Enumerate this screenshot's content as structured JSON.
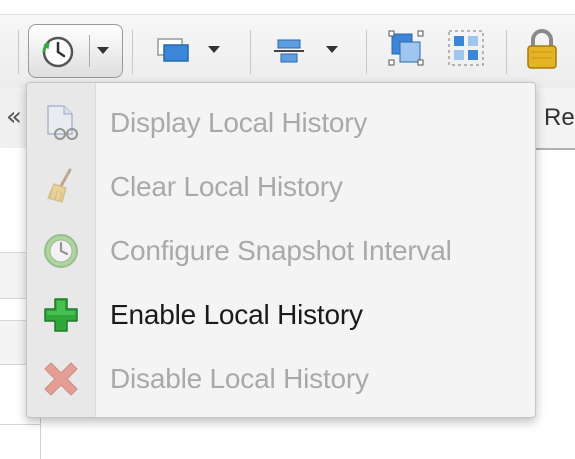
{
  "toolbar": {
    "buttons": [
      {
        "icon": "history-clock-icon",
        "has_dropdown": true,
        "state": "pressed"
      },
      {
        "icon": "window-stack-icon",
        "has_dropdown": true
      },
      {
        "icon": "align-center-icon",
        "has_dropdown": true
      },
      {
        "icon": "select-shapes-icon"
      },
      {
        "icon": "group-shapes-icon"
      },
      {
        "icon": "lock-icon"
      }
    ]
  },
  "left_tabs": {
    "collapse_symbol": "«"
  },
  "right_tab": {
    "label": "Re"
  },
  "menu": {
    "items": [
      {
        "label": "Display Local History",
        "icon": "document-glasses-icon",
        "enabled": false
      },
      {
        "label": "Clear Local History",
        "icon": "broom-icon",
        "enabled": false
      },
      {
        "label": "Configure Snapshot Interval",
        "icon": "clock-icon",
        "enabled": false
      },
      {
        "label": "Enable Local History",
        "icon": "green-plus-icon",
        "enabled": true
      },
      {
        "label": "Disable Local History",
        "icon": "red-x-icon",
        "enabled": false
      }
    ]
  },
  "colors": {
    "enabled_text": "#1a1a1a",
    "disabled_text": "#a9a9a9",
    "plus_green": "#2fa83a",
    "x_red": "#e0452e"
  }
}
